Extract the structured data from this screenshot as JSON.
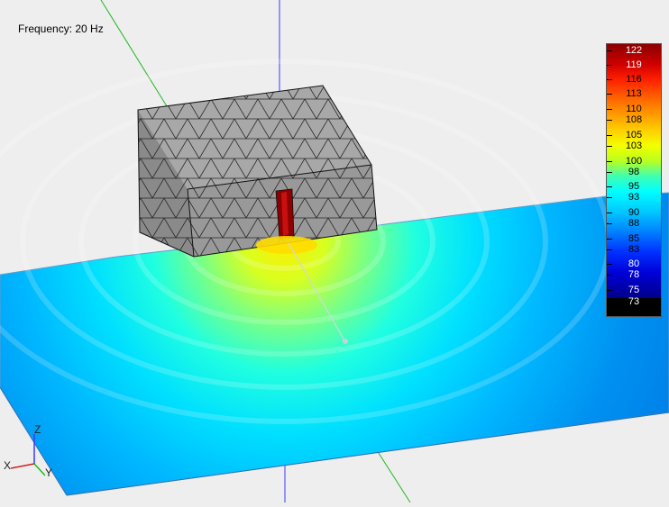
{
  "viewer": {
    "frequency_label": "Frequency: 20 Hz"
  },
  "colorbar": {
    "ticks": [
      "122",
      "119",
      "116",
      "113",
      "110",
      "108",
      "105",
      "103",
      "100",
      "98",
      "95",
      "93",
      "90",
      "88",
      "85",
      "83",
      "80",
      "78",
      "75",
      "73"
    ],
    "min_color": "#000000",
    "max_color": "#8b0000"
  },
  "axes_triad": {
    "x_label": "X",
    "y_label": "Y",
    "z_label": "Z"
  },
  "colors": {
    "background": "#eeeeee",
    "box_fill": "#9a9a9a",
    "mesh_lines": "#222222",
    "axis_blue": "#3a3aff",
    "axis_green": "#22b822"
  }
}
